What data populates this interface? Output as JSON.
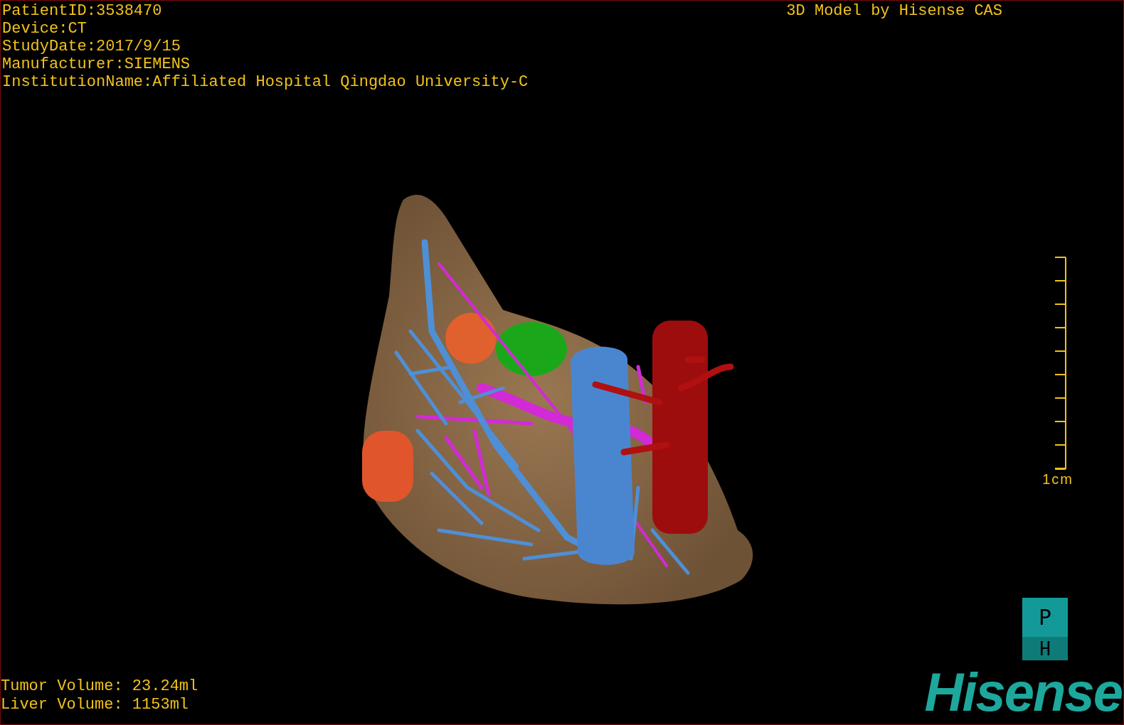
{
  "study_info": [
    "PatientID:3538470",
    "Device:CT",
    "StudyDate:2017/9/15",
    "Manufacturer:SIEMENS",
    "InstitutionName:Affiliated Hospital Qingdao University-C"
  ],
  "credit": "3D Model by Hisense CAS",
  "scale_bar": {
    "label": "1cm"
  },
  "volumes": [
    "Tumor Volume: 23.24ml",
    "Liver Volume: 1153ml"
  ],
  "orientation_marker": {
    "top": "P",
    "bottom": "H"
  },
  "logo": {
    "text": "Hisense"
  }
}
